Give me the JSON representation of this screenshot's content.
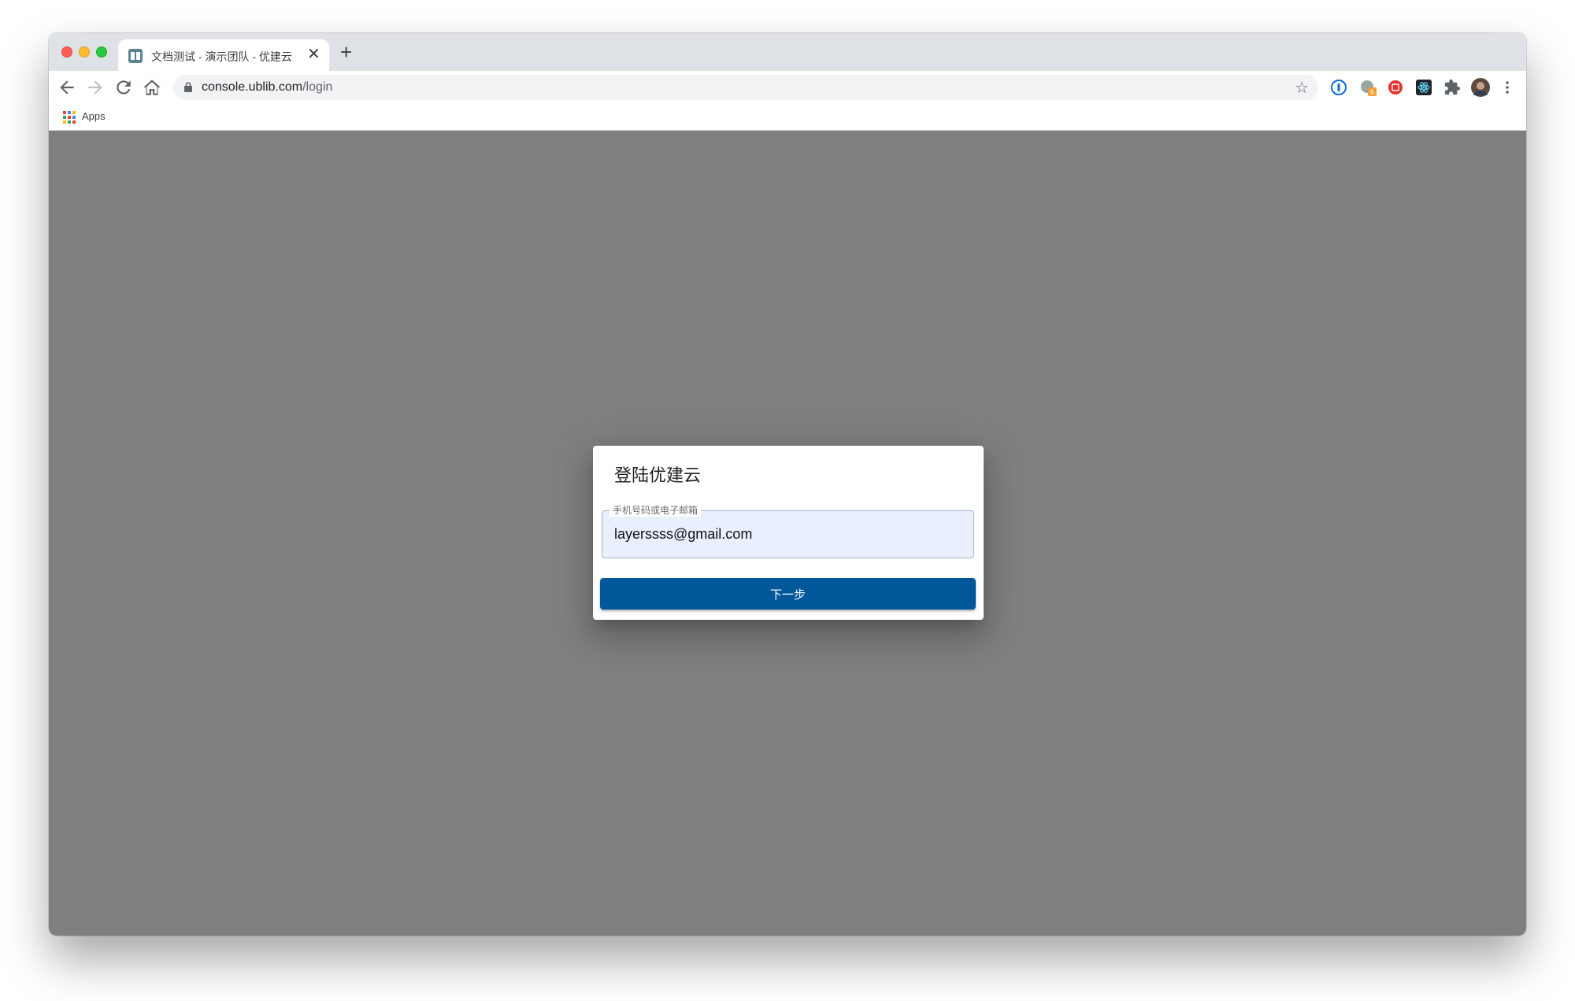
{
  "browser": {
    "tab": {
      "title": "文档测试 - 演示团队 - 优建云",
      "close_glyph": "✕"
    },
    "new_tab_glyph": "+",
    "address": {
      "host": "console.ublib.com",
      "path": "/login"
    },
    "bookmarks": [
      {
        "label": "Apps"
      }
    ],
    "extensions": [
      "1password-icon",
      "badge-extension-icon",
      "red-extension-icon",
      "react-devtools-icon",
      "puzzle-extensions-icon",
      "profile-avatar",
      "menu-dots-icon"
    ],
    "extension_badge": "6",
    "colors": {
      "tabstrip": "#dee1e6",
      "omnibox": "#f1f3f4"
    }
  },
  "login": {
    "title": "登陆优建云",
    "field_label": "手机号码或电子邮箱",
    "field_value": "layerssss@gmail.com",
    "next_label": "下一步",
    "colors": {
      "overlay": "#7f7f7f",
      "button": "#00589b",
      "field_fill": "#e8f0fe"
    }
  }
}
